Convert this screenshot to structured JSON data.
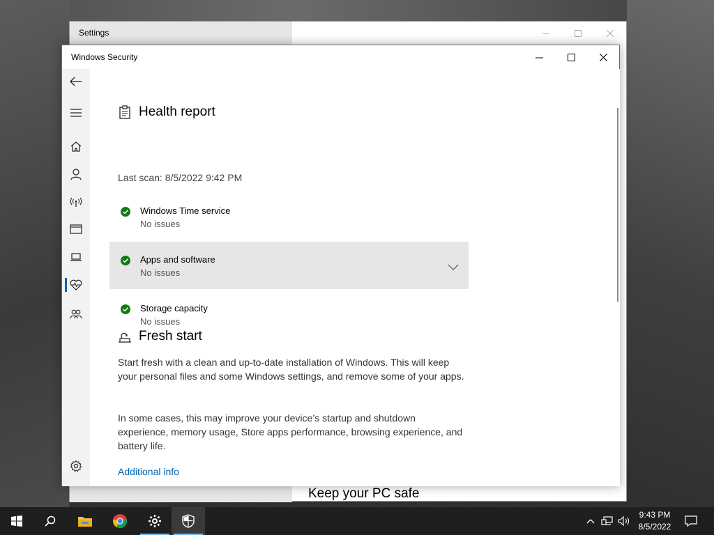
{
  "settings_window": {
    "title": "Settings",
    "body_heading": "Keep your PC safe"
  },
  "security_window": {
    "title": "Windows Security",
    "nav_items": [
      {
        "name": "back-arrow-icon"
      },
      {
        "name": "hamburger-menu-icon"
      },
      {
        "name": "home-icon"
      },
      {
        "name": "account-icon"
      },
      {
        "name": "firewall-network-icon"
      },
      {
        "name": "app-browser-control-icon"
      },
      {
        "name": "device-security-icon"
      },
      {
        "name": "device-performance-health-icon",
        "active": true
      },
      {
        "name": "family-options-icon"
      },
      {
        "name": "settings-gear-icon"
      }
    ],
    "health_report": {
      "title": "Health report",
      "last_scan": "Last scan: 8/5/2022 9:42 PM",
      "items": [
        {
          "name": "Windows Time service",
          "status": "No issues"
        },
        {
          "name": "Apps and software",
          "status": "No issues",
          "expandable": true
        },
        {
          "name": "Storage capacity",
          "status": "No issues"
        }
      ]
    },
    "fresh_start": {
      "title": "Fresh start",
      "paragraph1": "Start fresh with a clean and up-to-date installation of Windows. This will keep your personal files and some Windows settings, and remove some of your apps.",
      "paragraph2": "In some cases, this may improve your device’s startup and shutdown experience, memory usage, Store apps performance, browsing experience, and battery life.",
      "link": "Additional info"
    }
  },
  "taskbar": {
    "apps": [
      "start-icon",
      "search-icon",
      "file-explorer-icon",
      "chrome-icon",
      "settings-icon",
      "windows-security-icon"
    ],
    "time": "9:43 PM",
    "date": "8/5/2022"
  },
  "colors": {
    "accent": "#0063b1",
    "ok_green": "#107c10"
  }
}
